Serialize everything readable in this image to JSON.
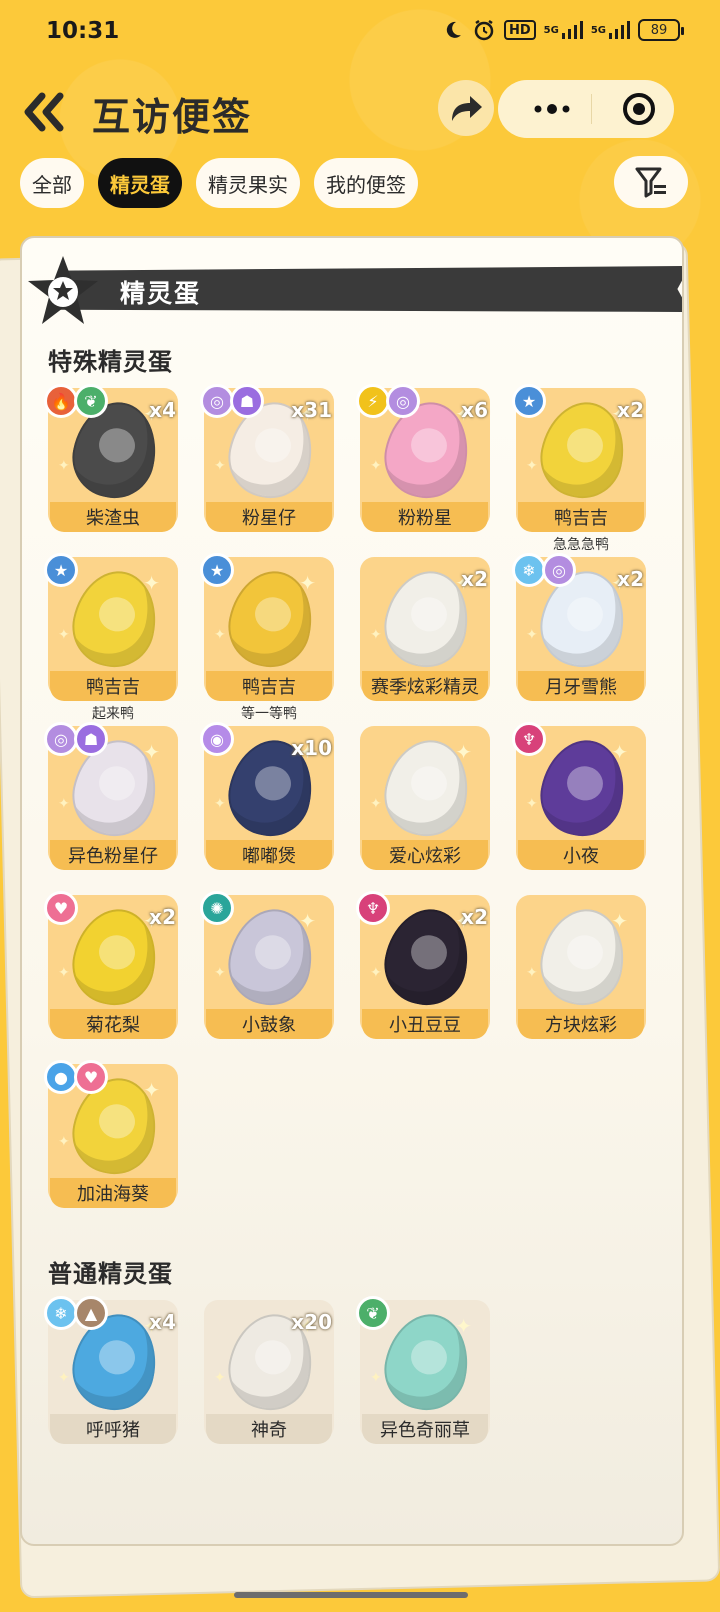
{
  "status_bar": {
    "time": "10:31",
    "hd": "HD",
    "signal1": "5G",
    "signal2": "5G",
    "battery": "89"
  },
  "header": {
    "title": "互访便签"
  },
  "tabs": [
    {
      "label": "全部",
      "active": false
    },
    {
      "label": "精灵蛋",
      "active": true
    },
    {
      "label": "精灵果实",
      "active": false
    },
    {
      "label": "我的便签",
      "active": false
    }
  ],
  "section": {
    "title": "精灵蛋"
  },
  "special": {
    "title": "特殊精灵蛋",
    "eggs": [
      {
        "name": "柴渣虫",
        "count": "x4",
        "subname": "",
        "badges": [
          "fire",
          "grass"
        ]
      },
      {
        "name": "粉星仔",
        "count": "x31",
        "subname": "",
        "badges": [
          "spiral",
          "ghost"
        ]
      },
      {
        "name": "粉粉星",
        "count": "x6",
        "subname": "",
        "badges": [
          "electric",
          "spiral"
        ]
      },
      {
        "name": "鸭吉吉",
        "count": "x2",
        "subname": "急急急鸭",
        "badges": [
          "star"
        ]
      },
      {
        "name": "鸭吉吉",
        "count": "",
        "subname": "起来鸭",
        "badges": [
          "star"
        ]
      },
      {
        "name": "鸭吉吉",
        "count": "",
        "subname": "等一等鸭",
        "badges": [
          "star"
        ]
      },
      {
        "name": "赛季炫彩精灵",
        "count": "x2",
        "subname": "",
        "badges": []
      },
      {
        "name": "月牙雪熊",
        "count": "x2",
        "subname": "",
        "badges": [
          "ice",
          "spiral"
        ]
      },
      {
        "name": "异色粉星仔",
        "count": "",
        "subname": "",
        "badges": [
          "spiral",
          "ghost"
        ]
      },
      {
        "name": "嘟嘟煲",
        "count": "x10",
        "subname": "",
        "badges": [
          "bubble"
        ]
      },
      {
        "name": "爱心炫彩",
        "count": "",
        "subname": "",
        "badges": []
      },
      {
        "name": "小夜",
        "count": "",
        "subname": "",
        "badges": [
          "demon"
        ]
      },
      {
        "name": "菊花梨",
        "count": "x2",
        "subname": "",
        "badges": [
          "heart"
        ]
      },
      {
        "name": "小鼓象",
        "count": "",
        "subname": "",
        "badges": [
          "gear"
        ]
      },
      {
        "name": "小丑豆豆",
        "count": "x2",
        "subname": "",
        "badges": [
          "demon"
        ]
      },
      {
        "name": "方块炫彩",
        "count": "",
        "subname": "",
        "badges": []
      },
      {
        "name": "加油海葵",
        "count": "",
        "subname": "",
        "badges": [
          "water",
          "heart"
        ]
      }
    ]
  },
  "normal": {
    "title": "普通精灵蛋",
    "eggs": [
      {
        "name": "呼呼猪",
        "count": "x4",
        "subname": "",
        "badges": [
          "ice",
          "ground"
        ]
      },
      {
        "name": "神奇",
        "count": "x20",
        "subname": "",
        "badges": []
      },
      {
        "name": "异色奇丽草",
        "count": "",
        "subname": "",
        "badges": [
          "grass"
        ]
      }
    ]
  },
  "badge_colors": {
    "fire": "#e8613a",
    "grass": "#4caf6a",
    "spiral": "#b38de0",
    "ghost": "#9a6de0",
    "electric": "#f1c21b",
    "star": "#4a8fd8",
    "ice": "#6cc2ef",
    "bubble": "#b58be8",
    "demon": "#d8417a",
    "heart": "#ee6f94",
    "gear": "#2aa59a",
    "water": "#4aa3e8",
    "ground": "#a7866a"
  },
  "egg_colors": [
    "#4b4b4b",
    "#f5ede4",
    "#f4a7c6",
    "#f2d33b",
    "#f2d33b",
    "#f2c53a",
    "#f1efe8",
    "#e7eef6",
    "#e8e2ea",
    "#34406e",
    "#f1efe8",
    "#5e3c9a",
    "#f2d230",
    "#c9c6d9",
    "#2b2433",
    "#f1efe8",
    "#f2d33b",
    "#4da9e0",
    "#eeeae2",
    "#8ed6c8"
  ]
}
